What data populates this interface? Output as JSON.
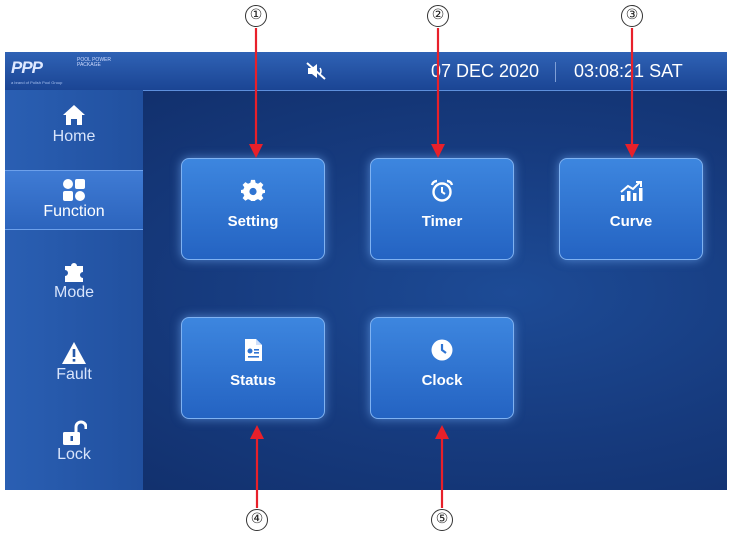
{
  "header": {
    "logo_mark": "PPP",
    "logo_words": "POOL POWER PACKAGE",
    "logo_tagline": "a brand of Polish Pool Group",
    "date": "07 DEC 2020",
    "time": "03:08:21 SAT",
    "mute_icon": "speaker-muted-icon"
  },
  "sidebar": {
    "items": [
      {
        "label": "Home",
        "icon": "home-icon"
      },
      {
        "label": "Function",
        "icon": "function-grid-icon",
        "active": true
      },
      {
        "label": "Mode",
        "icon": "puzzle-icon"
      },
      {
        "label": "Fault",
        "icon": "warning-icon"
      },
      {
        "label": "Lock",
        "icon": "unlock-icon"
      }
    ]
  },
  "tiles": [
    {
      "label": "Setting",
      "icon": "gear-icon"
    },
    {
      "label": "Timer",
      "icon": "alarm-clock-icon"
    },
    {
      "label": "Curve",
      "icon": "chart-icon"
    },
    {
      "label": "Status",
      "icon": "document-icon"
    },
    {
      "label": "Clock",
      "icon": "clock-icon"
    }
  ],
  "callouts": [
    "①",
    "②",
    "③",
    "④",
    "⑤"
  ],
  "colors": {
    "screen_bg": "#163a7d",
    "topbar": "#1b4594",
    "sidebar": "#2a5fb3",
    "tile": "#2f74d2",
    "arrow": "#e8202a"
  }
}
